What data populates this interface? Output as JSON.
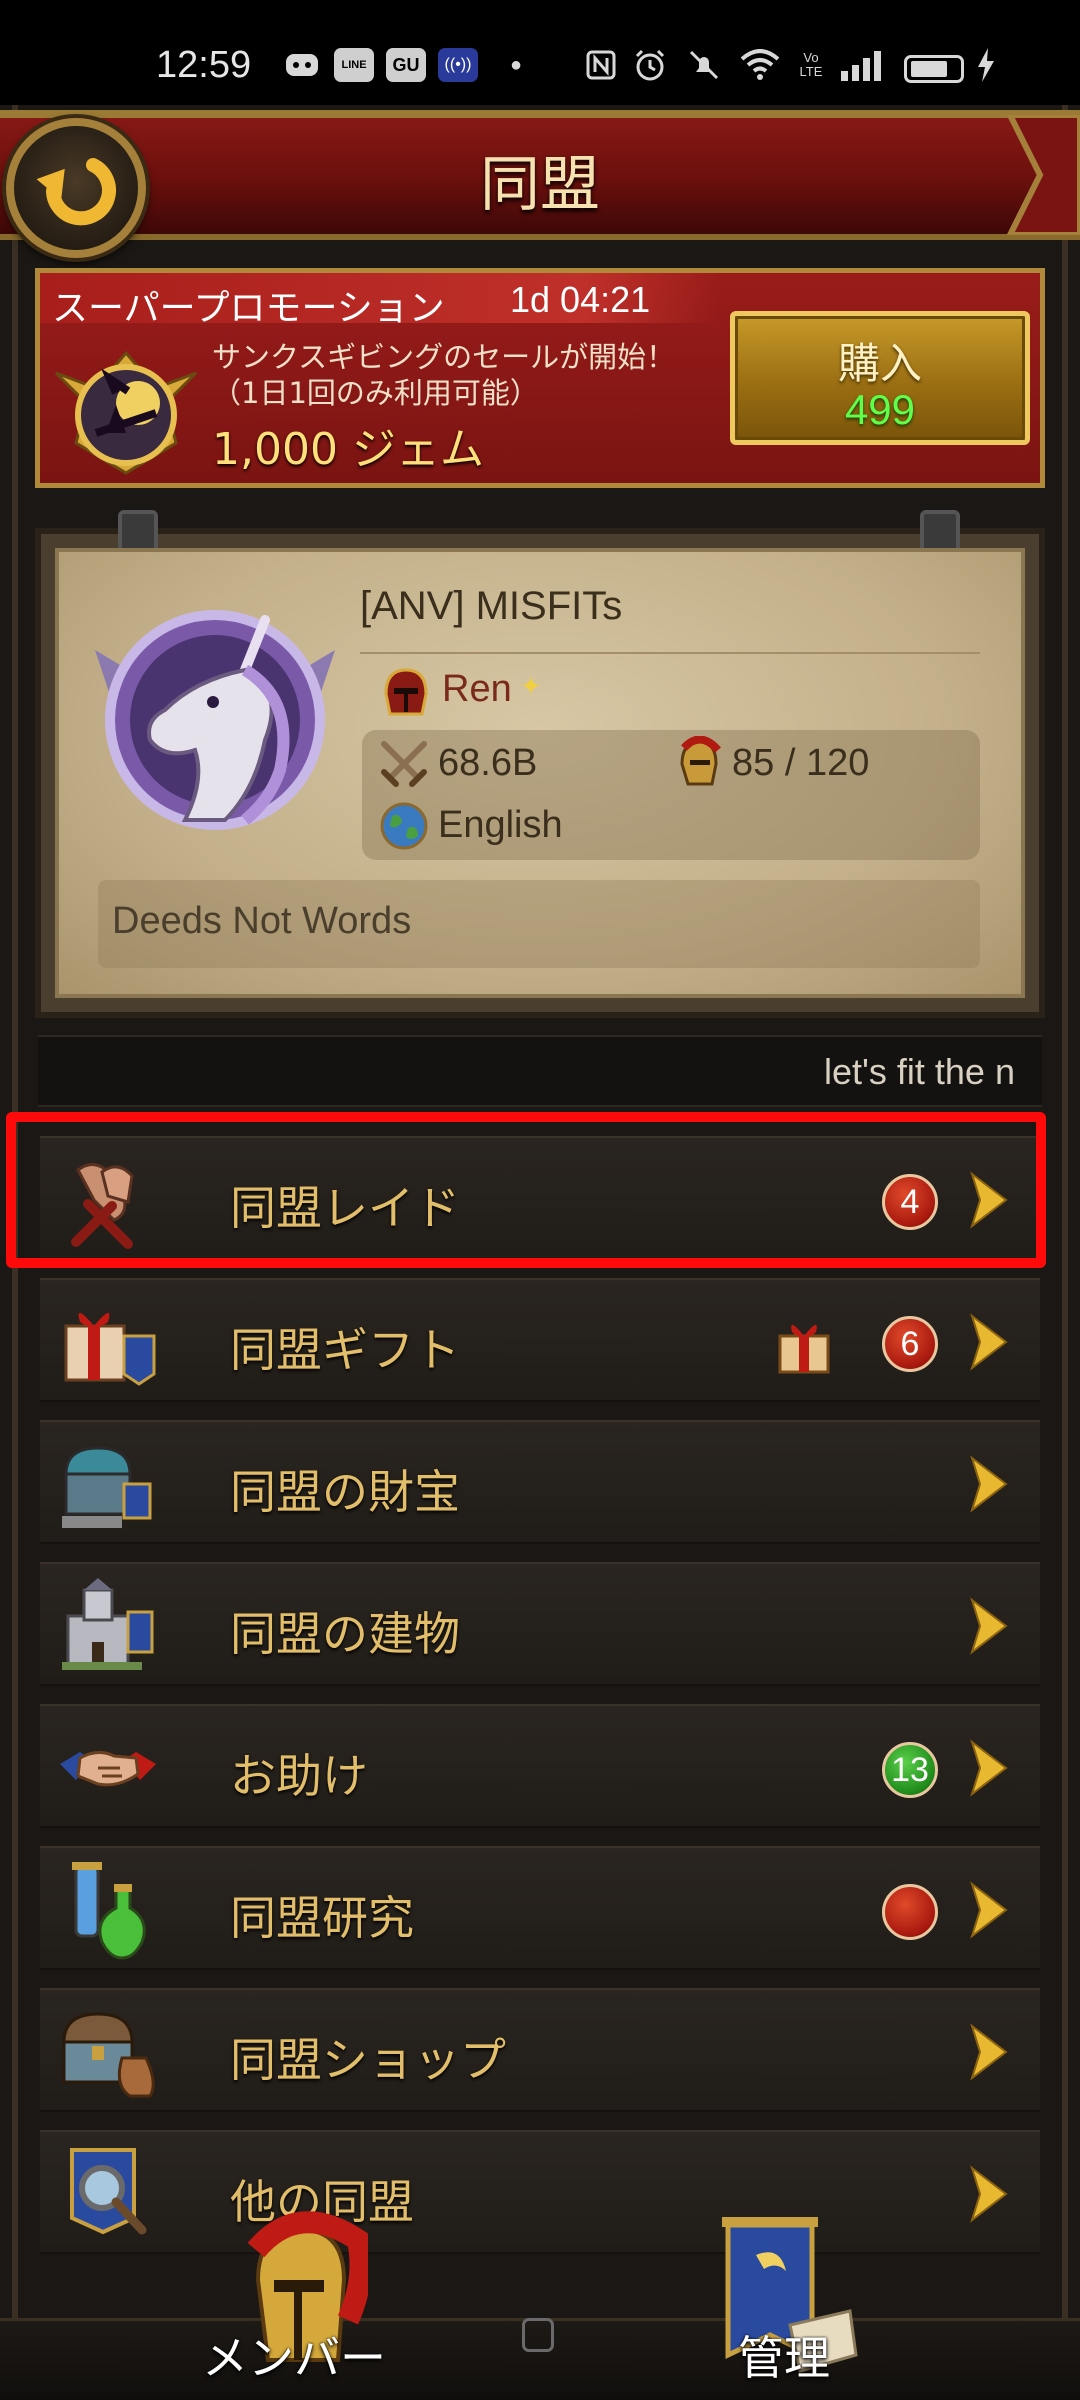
{
  "status_bar": {
    "time": "12:59",
    "icons": [
      "discord-icon",
      "line-icon",
      "gu-icon",
      "nfc-app-icon",
      "dot-icon",
      "nfc-icon",
      "alarm-icon",
      "mute-icon",
      "wifi-icon",
      "volte-icon",
      "signal-icon",
      "battery-icon",
      "charging-icon"
    ],
    "gu_label": "GU",
    "line_label": "LINE",
    "volte_label": "Vo\nLTE"
  },
  "header": {
    "title": "同盟"
  },
  "promo": {
    "title": "スーパープロモーション",
    "timer": "1d 04:21",
    "description": "サンクスギビングのセールが開始！（1日1回のみ利用可能）",
    "gems": "1,000 ジェム",
    "buy_label": "購入",
    "price": "499"
  },
  "alliance": {
    "name": "[ANV] MISFITs",
    "leader": "Ren",
    "power": "68.6B",
    "members": "85 / 120",
    "language": "English",
    "motto": "Deeds Not Words"
  },
  "ticker": {
    "text": "let's fit the n"
  },
  "menu": [
    {
      "label": "同盟レイド",
      "badge": "4",
      "badge_color": "#b0180e"
    },
    {
      "label": "同盟ギフト",
      "badge": "6",
      "badge_color": "#b0180e"
    },
    {
      "label": "同盟の財宝",
      "badge": ""
    },
    {
      "label": "同盟の建物",
      "badge": ""
    },
    {
      "label": "お助け",
      "badge": "13",
      "badge_color": "#1f8a1a"
    },
    {
      "label": "同盟研究",
      "badge": "",
      "badge_color": "#b0180e"
    },
    {
      "label": "同盟ショップ",
      "badge": ""
    },
    {
      "label": "他の同盟",
      "badge": ""
    }
  ],
  "bottom_nav": {
    "members_label": "メンバー",
    "manage_label": "管理"
  },
  "colors": {
    "accent_gold": "#e2be6a",
    "highlight_red": "#ff0a0a",
    "price_green": "#5dff4a"
  }
}
